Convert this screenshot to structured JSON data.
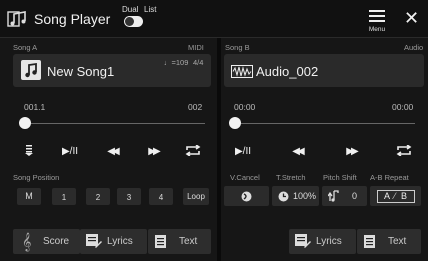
{
  "header": {
    "title": "Song Player",
    "dual_label": "Dual",
    "list_label": "List",
    "menu_label": "Menu",
    "close_glyph": "✕"
  },
  "songA": {
    "label": "Song A",
    "type": "MIDI",
    "name": "New Song1",
    "tempo": "♩=109",
    "time_sig": "4/4",
    "pos_start": "001.1",
    "pos_end": "002",
    "progress": 0,
    "section_label": "Song Position",
    "position_buttons": [
      "M",
      "1",
      "2",
      "3",
      "4",
      "Loop"
    ],
    "bottom": {
      "score": "Score",
      "lyrics": "Lyrics",
      "text": "Text"
    }
  },
  "songB": {
    "label": "Song B",
    "type": "Audio",
    "name": "Audio_002",
    "time_start": "00:00",
    "time_end": "00:00",
    "progress": 0,
    "vcancel_label": "V.Cancel",
    "tstretch_label": "T.Stretch",
    "pitch_label": "Pitch Shift",
    "ab_label": "A-B Repeat",
    "tstretch_value": "100%",
    "pitch_value": "0",
    "ab_a": "A",
    "ab_b": "B",
    "bottom": {
      "lyrics": "Lyrics",
      "text": "Text"
    }
  },
  "controls": {
    "play_pause": "▶/II",
    "rewind": "◀◀",
    "ffwd": "▶▶"
  },
  "colors": {
    "bg": "#101010",
    "panel": "#161616",
    "button": "#2b2b2b",
    "text": "#e8e8e8"
  }
}
